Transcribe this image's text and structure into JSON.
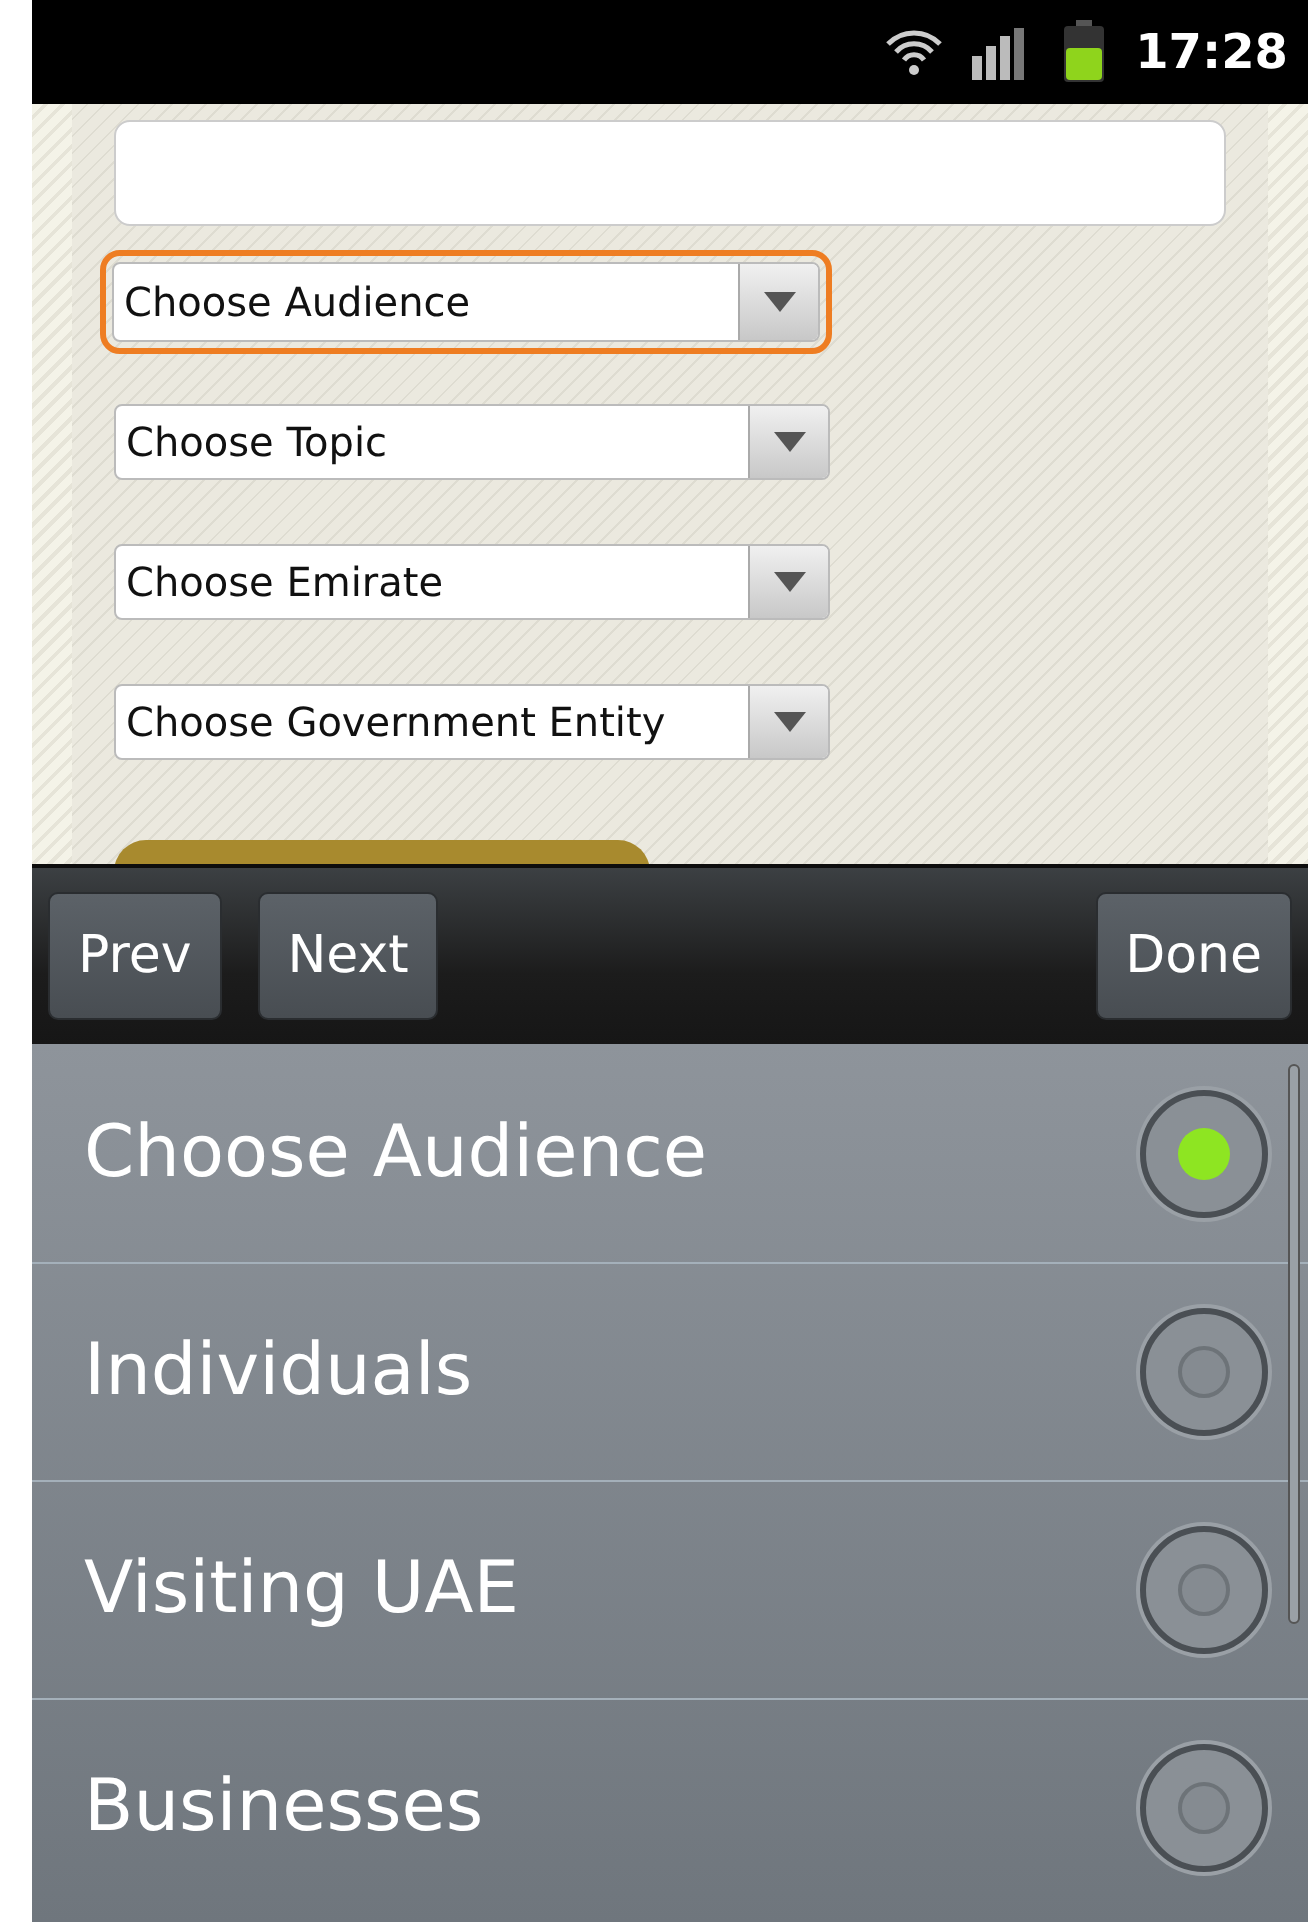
{
  "status_bar": {
    "time": "17:28"
  },
  "form": {
    "selects": [
      {
        "label": "Choose Audience",
        "focused": true
      },
      {
        "label": "Choose Topic",
        "focused": false
      },
      {
        "label": "Choose Emirate",
        "focused": false
      },
      {
        "label": "Choose Government Entity",
        "focused": false
      }
    ]
  },
  "toolbar": {
    "buttons": [
      "Prev",
      "Next",
      "Done"
    ]
  },
  "picker": {
    "options": [
      {
        "label": "Choose Audience",
        "selected": true
      },
      {
        "label": "Individuals",
        "selected": false
      },
      {
        "label": "Visiting UAE",
        "selected": false
      },
      {
        "label": "Businesses",
        "selected": false
      }
    ]
  }
}
